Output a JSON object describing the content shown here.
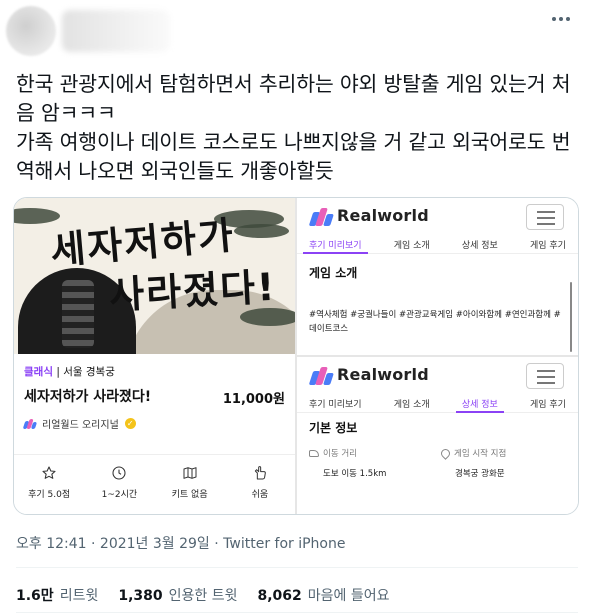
{
  "tweet": {
    "text": "한국 관광지에서 탐험하면서 추리하는 야외 방탈출 게임 있는거 처음 암ㅋㅋㅋ\n가족 여행이나 데이트 코스로도 나쁘지않을 거 같고 외국어로도 번역해서 나오면 외국인들도 개좋아할듯",
    "timestamp": "오후 12:41 · 2021년 3월 29일 · Twitter for iPhone"
  },
  "stats": [
    {
      "value": "1.6만",
      "label": "리트윗"
    },
    {
      "value": "1,380",
      "label": "인용한 트윗"
    },
    {
      "value": "8,062",
      "label": "마음에 들어요"
    }
  ],
  "game_card": {
    "poster_line1": "세자저하가",
    "poster_line2": "사라졌다!",
    "category_tag": "클래식",
    "location": "서울 경복궁",
    "title": "세자저하가 사라졌다!",
    "price": "11,000원",
    "brand": "리얼월드 오리지널",
    "features": [
      {
        "icon": "star-icon",
        "label": "후기 5.0점"
      },
      {
        "icon": "clock-icon",
        "label": "1~2시간"
      },
      {
        "icon": "map-icon",
        "label": "키트 없음"
      },
      {
        "icon": "pointer-icon",
        "label": "쉬움"
      }
    ]
  },
  "realworld": {
    "logo_text": "Realworld",
    "tabs": [
      "후기 미리보기",
      "게임 소개",
      "상세 정보",
      "게임 후기"
    ],
    "intro": {
      "section_title": "게임 소개",
      "hashtags": "#역사체험 #궁궐나들이 #관광교육게임 #아이와함께 #연인과함께 #데이트코스"
    },
    "detail": {
      "section_title": "기본 정보",
      "move_label": "이동 거리",
      "move_value": "도보 이동 1.5km",
      "start_label": "게임 시작 지점",
      "start_value": "경복궁 광화문"
    }
  },
  "colors": {
    "accent": "#8b42f5",
    "logo_blue": "#4a7cf7",
    "logo_pink": "#e85fb8",
    "muted": "#536471"
  }
}
